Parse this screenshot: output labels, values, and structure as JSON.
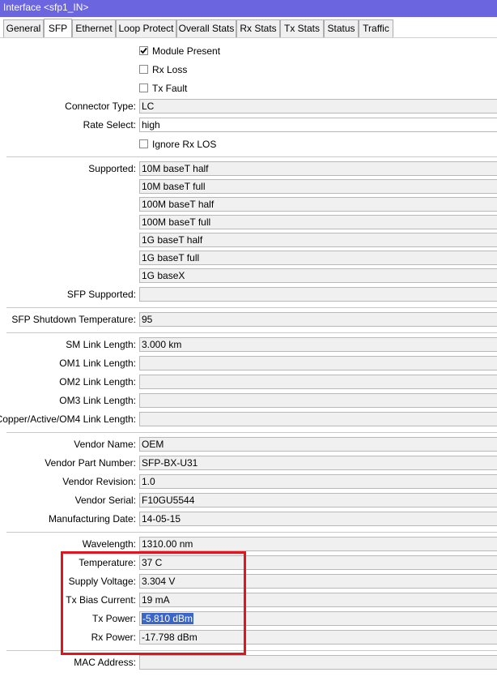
{
  "window": {
    "title": "Interface <sfp1_IN>"
  },
  "tabs": [
    "General",
    "SFP",
    "Ethernet",
    "Loop Protect",
    "Overall Stats",
    "Rx Stats",
    "Tx Stats",
    "Status",
    "Traffic"
  ],
  "checkboxes": {
    "module_present": {
      "label": "Module Present",
      "checked": true
    },
    "rx_loss": {
      "label": "Rx Loss",
      "checked": false
    },
    "tx_fault": {
      "label": "Tx Fault",
      "checked": false
    },
    "ignore_rx_los": {
      "label": "Ignore Rx LOS",
      "checked": false
    }
  },
  "fields": {
    "connector_type": {
      "label": "Connector Type:",
      "value": "LC"
    },
    "rate_select": {
      "label": "Rate Select:",
      "value": "high"
    },
    "supported": {
      "label": "Supported:",
      "values": [
        "10M baseT half",
        "10M baseT full",
        "100M baseT half",
        "100M baseT full",
        "1G baseT half",
        "1G baseT full",
        "1G baseX"
      ]
    },
    "sfp_supported": {
      "label": "SFP Supported:",
      "value": ""
    },
    "sfp_shutdown_temp": {
      "label": "SFP Shutdown Temperature:",
      "value": "95"
    },
    "sm_link_length": {
      "label": "SM Link Length:",
      "value": "3.000 km"
    },
    "om1_link_length": {
      "label": "OM1 Link Length:",
      "value": ""
    },
    "om2_link_length": {
      "label": "OM2 Link Length:",
      "value": ""
    },
    "om3_link_length": {
      "label": "OM3 Link Length:",
      "value": ""
    },
    "copper_link_length": {
      "label": "Copper/Active/OM4 Link Length:",
      "value": ""
    },
    "vendor_name": {
      "label": "Vendor Name:",
      "value": "OEM"
    },
    "vendor_part_number": {
      "label": "Vendor Part Number:",
      "value": "SFP-BX-U31"
    },
    "vendor_revision": {
      "label": "Vendor Revision:",
      "value": "1.0"
    },
    "vendor_serial": {
      "label": "Vendor Serial:",
      "value": "F10GU5544"
    },
    "manufacturing_date": {
      "label": "Manufacturing Date:",
      "value": "14-05-15"
    },
    "wavelength": {
      "label": "Wavelength:",
      "value": "1310.00 nm"
    },
    "temperature": {
      "label": "Temperature:",
      "value": "37 C"
    },
    "supply_voltage": {
      "label": "Supply Voltage:",
      "value": "3.304 V"
    },
    "tx_bias_current": {
      "label": "Tx Bias Current:",
      "value": "19 mA"
    },
    "tx_power": {
      "label": "Tx Power:",
      "value": "-5.810 dBm"
    },
    "rx_power": {
      "label": "Rx Power:",
      "value": "-17.798 dBm"
    },
    "mac_address": {
      "label": "MAC Address:",
      "value": ""
    }
  },
  "colors": {
    "titlebar": "#6b66e0",
    "highlight": "#e3141b",
    "selection": "#3a66c9"
  }
}
